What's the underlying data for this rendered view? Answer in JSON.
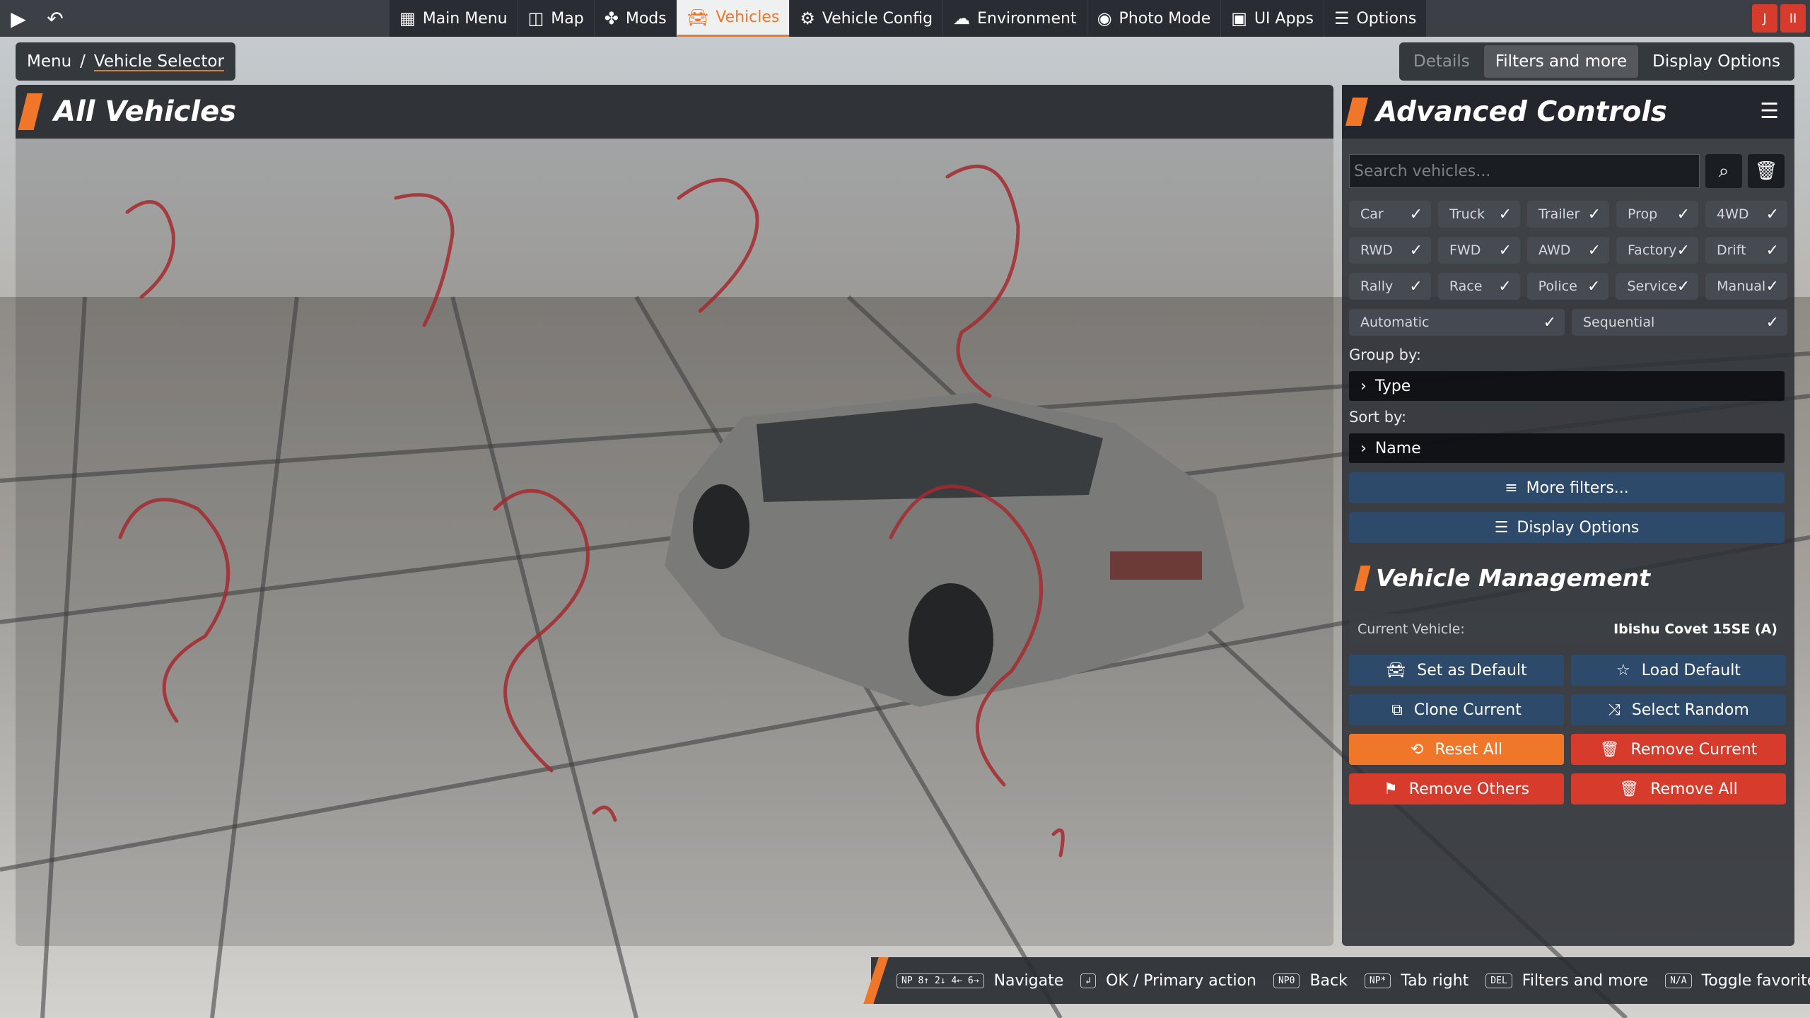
{
  "topbar": {
    "play_icon": "play-icon",
    "back_icon": "undo-icon",
    "items": [
      {
        "label": "Main Menu",
        "icon": "grid-icon"
      },
      {
        "label": "Map",
        "icon": "map-icon"
      },
      {
        "label": "Mods",
        "icon": "puzzle-icon"
      },
      {
        "label": "Vehicles",
        "icon": "car-icon",
        "active": true
      },
      {
        "label": "Vehicle Config",
        "icon": "engine-icon"
      },
      {
        "label": "Environment",
        "icon": "weather-icon"
      },
      {
        "label": "Photo Mode",
        "icon": "camera-icon"
      },
      {
        "label": "UI Apps",
        "icon": "apps-icon"
      },
      {
        "label": "Options",
        "icon": "sliders-icon"
      }
    ],
    "right_badges": [
      "J",
      "II"
    ]
  },
  "breadcrumb": {
    "root": "Menu",
    "separator": "/",
    "current": "Vehicle Selector"
  },
  "view_tabs": [
    "Details",
    "Filters and more",
    "Display Options"
  ],
  "left_panel": {
    "title": "All Vehicles"
  },
  "right_panel": {
    "title": "Advanced Controls",
    "search_placeholder": "Search vehicles...",
    "chips": [
      [
        "Car",
        "Truck",
        "Trailer",
        "Prop",
        "4WD"
      ],
      [
        "RWD",
        "FWD",
        "AWD",
        "Factory",
        "Drift"
      ],
      [
        "Rally",
        "Race",
        "Police",
        "Service",
        "Manual"
      ],
      [
        "Automatic",
        "Sequential"
      ]
    ],
    "check": "✓",
    "group_by_label": "Group by:",
    "group_by_value": "Type",
    "sort_by_label": "Sort by:",
    "sort_by_value": "Name",
    "more_filters": "More filters...",
    "display_options": "Display Options",
    "vm_title": "Vehicle Management",
    "current_label": "Current Vehicle:",
    "current_value": "Ibishu Covet 15SE (A)",
    "actions": {
      "set_default": "Set as Default",
      "load_default": "Load Default",
      "clone_current": "Clone Current",
      "select_random": "Select Random",
      "reset_all": "Reset All",
      "remove_current": "Remove Current",
      "remove_others": "Remove Others",
      "remove_all": "Remove All"
    }
  },
  "bottombar": [
    {
      "key": "NP 8↑ 2↓ 4← 6→",
      "label": "Navigate"
    },
    {
      "key": "↲",
      "label": "OK / Primary action"
    },
    {
      "key": "NP0",
      "label": "Back"
    },
    {
      "key": "NP*",
      "label": "Tab right"
    },
    {
      "key": "DEL",
      "label": "Filters and more"
    },
    {
      "key": "N/A",
      "label": "Toggle favorite"
    }
  ],
  "colors": {
    "accent": "#f0762a",
    "danger": "#d63b2c",
    "primary": "#2d4a6a"
  }
}
